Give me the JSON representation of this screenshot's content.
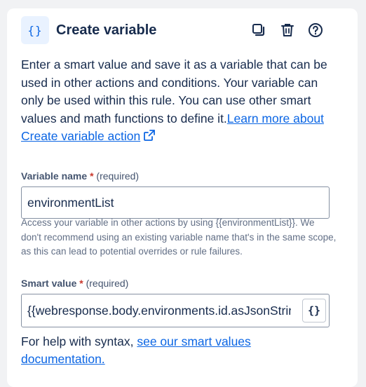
{
  "header": {
    "icon_label": "{}",
    "title": "Create variable",
    "actions": [
      {
        "name": "duplicate",
        "icon": "copy-icon"
      },
      {
        "name": "delete",
        "icon": "trash-icon"
      },
      {
        "name": "help",
        "icon": "question-circle-icon"
      }
    ]
  },
  "description": {
    "text": "Enter a smart value and save it as a variable that can be used in other actions and conditions. Your variable can only be used within this rule. You can use other smart values and math functions to define it.",
    "link_text": "Learn more about Create variable action",
    "link_icon": "external-link-icon"
  },
  "variable_name": {
    "label": "Variable name",
    "required_mark": "*",
    "required_text": "(required)",
    "value": "environmentList",
    "helper": "Access your variable in other actions by using {{environmentList}}. We don't recommend using an existing variable name that's in the same scope, as this can lead to potential overrides or rule failures."
  },
  "smart_value": {
    "label": "Smart value",
    "required_mark": "*",
    "required_text": "(required)",
    "value": "{{webresponse.body.environments.id.asJsonStringArray}}",
    "button_label": "{}"
  },
  "syntax_help": {
    "text": "For help with syntax, ",
    "link_text": "see our smart values documentation."
  },
  "colors": {
    "accent": "#0c66e4",
    "required": "#c9372c",
    "text": "#172b4d",
    "subtle_text": "#626f86"
  }
}
